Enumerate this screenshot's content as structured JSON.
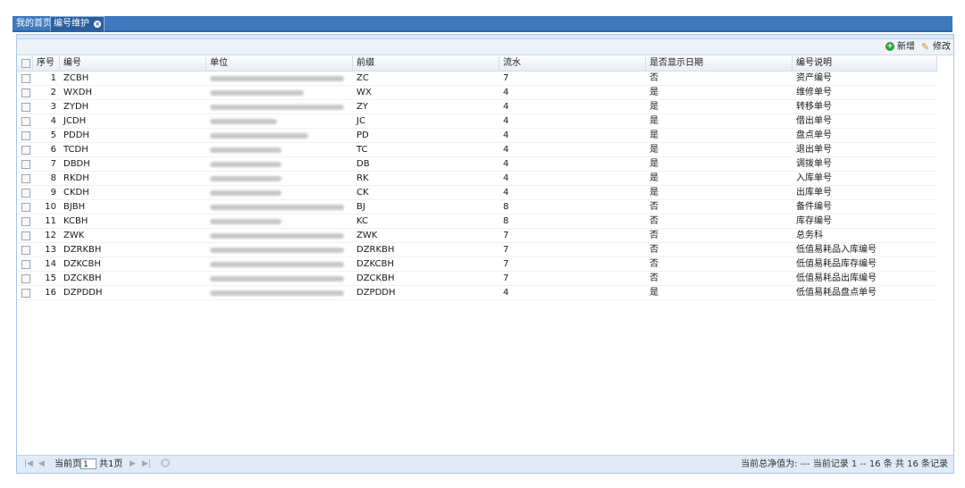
{
  "tabs": [
    {
      "label": "我的首页"
    },
    {
      "label": "编号维护",
      "close": "×"
    }
  ],
  "toolbar": {
    "add_label": "新增",
    "edit_label": "修改"
  },
  "columns": {
    "seq": "序号",
    "code": "编号",
    "unit": "单位",
    "prefix": "前缀",
    "flow": "流水",
    "show_date": "是否显示日期",
    "desc": "编号说明"
  },
  "rows": [
    {
      "seq": "1",
      "code": "ZCBH",
      "prefix": "ZC",
      "flow": "7",
      "show_date": "否",
      "desc": "资产编号"
    },
    {
      "seq": "2",
      "code": "WXDH",
      "prefix": "WX",
      "flow": "4",
      "show_date": "是",
      "desc": "维修单号"
    },
    {
      "seq": "3",
      "code": "ZYDH",
      "prefix": "ZY",
      "flow": "4",
      "show_date": "是",
      "desc": "转移单号"
    },
    {
      "seq": "4",
      "code": "JCDH",
      "prefix": "JC",
      "flow": "4",
      "show_date": "是",
      "desc": "借出单号"
    },
    {
      "seq": "5",
      "code": "PDDH",
      "prefix": "PD",
      "flow": "4",
      "show_date": "是",
      "desc": "盘点单号"
    },
    {
      "seq": "6",
      "code": "TCDH",
      "prefix": "TC",
      "flow": "4",
      "show_date": "是",
      "desc": "退出单号"
    },
    {
      "seq": "7",
      "code": "DBDH",
      "prefix": "DB",
      "flow": "4",
      "show_date": "是",
      "desc": "调拨单号"
    },
    {
      "seq": "8",
      "code": "RKDH",
      "prefix": "RK",
      "flow": "4",
      "show_date": "是",
      "desc": "入库单号"
    },
    {
      "seq": "9",
      "code": "CKDH",
      "prefix": "CK",
      "flow": "4",
      "show_date": "是",
      "desc": "出库单号"
    },
    {
      "seq": "10",
      "code": "BJBH",
      "prefix": "BJ",
      "flow": "8",
      "show_date": "否",
      "desc": "备件编号"
    },
    {
      "seq": "11",
      "code": "KCBH",
      "prefix": "KC",
      "flow": "8",
      "show_date": "否",
      "desc": "库存编号"
    },
    {
      "seq": "12",
      "code": "ZWK",
      "prefix": "ZWK",
      "flow": "7",
      "show_date": "否",
      "desc": "总务科"
    },
    {
      "seq": "13",
      "code": "DZRKBH",
      "prefix": "DZRKBH",
      "flow": "7",
      "show_date": "否",
      "desc": "低值易耗品入库编号"
    },
    {
      "seq": "14",
      "code": "DZKCBH",
      "prefix": "DZKCBH",
      "flow": "7",
      "show_date": "否",
      "desc": "低值易耗品库存编号"
    },
    {
      "seq": "15",
      "code": "DZCKBH",
      "prefix": "DZCKBH",
      "flow": "7",
      "show_date": "否",
      "desc": "低值易耗品出库编号"
    },
    {
      "seq": "16",
      "code": "DZPDDH",
      "prefix": "DZPDDH",
      "flow": "4",
      "show_date": "是",
      "desc": "低值易耗品盘点单号"
    }
  ],
  "pager": {
    "current_label": "当前页",
    "current_page": "1",
    "total_label": "共1页",
    "status_text": "当前总净值为: --- 当前记录 1 -- 16 条 共 16 条记录"
  }
}
